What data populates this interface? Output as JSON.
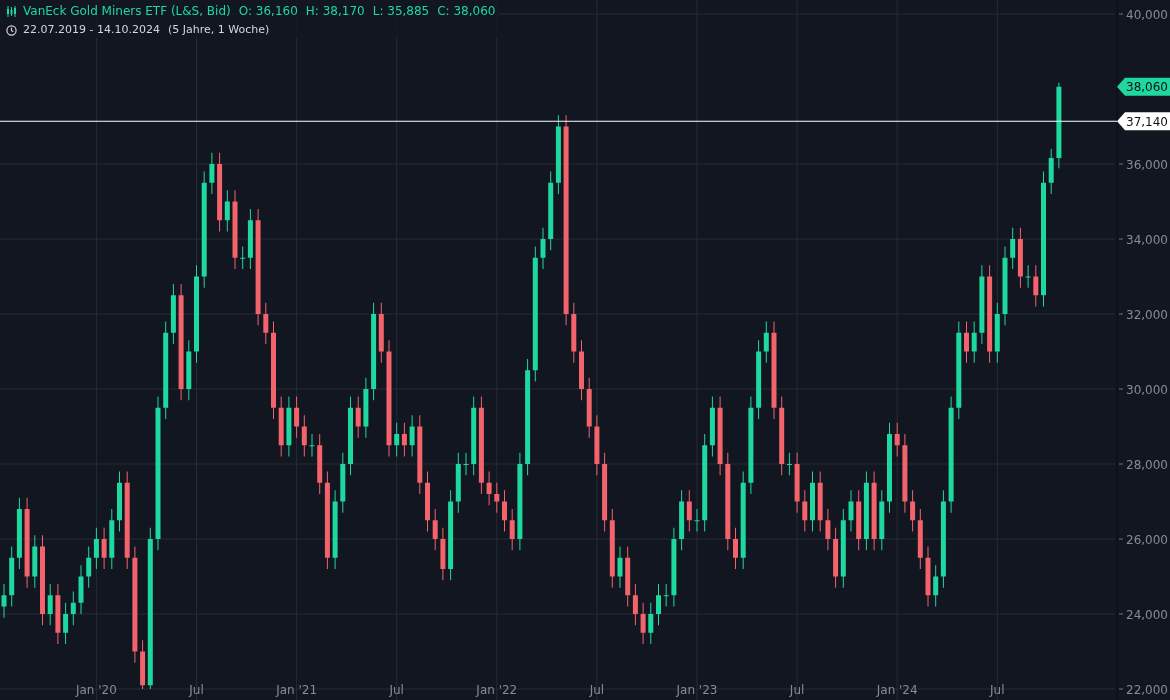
{
  "header": {
    "title": "VanEck Gold Miners ETF (L&S, Bid)",
    "ohlc": [
      "O: 36,160",
      "H: 38,170",
      "L: 35,885",
      "C: 38,060"
    ],
    "range": "22.07.2019 - 14.10.2024",
    "duration": "(5 Jahre, 1 Woche)"
  },
  "chart": {
    "chart_data": {
      "type": "candlestick",
      "categories": [
        null,
        null,
        null,
        null,
        null,
        null,
        null,
        null,
        null,
        null,
        null,
        null,
        "Jan '20",
        null,
        null,
        null,
        null,
        null,
        null,
        null,
        null,
        null,
        null,
        null,
        null,
        "Jul",
        null,
        null,
        null,
        null,
        null,
        null,
        null,
        null,
        null,
        null,
        null,
        null,
        "Jan '21",
        null,
        null,
        null,
        null,
        null,
        null,
        null,
        null,
        null,
        null,
        null,
        null,
        "Jul",
        null,
        null,
        null,
        null,
        null,
        null,
        null,
        null,
        null,
        null,
        null,
        null,
        "Jan '22",
        null,
        null,
        null,
        null,
        null,
        null,
        null,
        null,
        null,
        null,
        null,
        null,
        "Jul",
        null,
        null,
        null,
        null,
        null,
        null,
        null,
        null,
        null,
        null,
        null,
        null,
        "Jan '23",
        null,
        null,
        null,
        null,
        null,
        null,
        null,
        null,
        null,
        null,
        null,
        null,
        "Jul",
        null,
        null,
        null,
        null,
        null,
        null,
        null,
        null,
        null,
        null,
        null,
        null,
        "Jan '24",
        null,
        null,
        null,
        null,
        null,
        null,
        null,
        null,
        null,
        null,
        null,
        null,
        "Jul",
        null,
        null,
        null,
        null,
        null,
        null,
        null,
        null
      ],
      "ohlc": [
        [
          24200,
          24800,
          23900,
          24500
        ],
        [
          24500,
          25800,
          24200,
          25500
        ],
        [
          25500,
          27100,
          25200,
          26800
        ],
        [
          26800,
          27100,
          24700,
          25000
        ],
        [
          25000,
          26100,
          24700,
          25800
        ],
        [
          25800,
          26100,
          23700,
          24000
        ],
        [
          24000,
          24800,
          23700,
          24500
        ],
        [
          24500,
          24800,
          23200,
          23500
        ],
        [
          23500,
          24300,
          23200,
          24000
        ],
        [
          24000,
          24600,
          23700,
          24300
        ],
        [
          24300,
          25300,
          24000,
          25000
        ],
        [
          25000,
          25800,
          24700,
          25500
        ],
        [
          25500,
          26300,
          25200,
          26000
        ],
        [
          26000,
          26300,
          25200,
          25500
        ],
        [
          25500,
          26800,
          25200,
          26500
        ],
        [
          26500,
          27800,
          26200,
          27500
        ],
        [
          27500,
          27800,
          25200,
          25500
        ],
        [
          25500,
          25800,
          22700,
          23000
        ],
        [
          23000,
          23300,
          22000,
          22100
        ],
        [
          22100,
          26300,
          22000,
          26000
        ],
        [
          26000,
          29800,
          25700,
          29500
        ],
        [
          29500,
          31800,
          29200,
          31500
        ],
        [
          31500,
          32800,
          31200,
          32500
        ],
        [
          32500,
          32800,
          29700,
          30000
        ],
        [
          30000,
          31300,
          29700,
          31000
        ],
        [
          31000,
          33300,
          30700,
          33000
        ],
        [
          33000,
          35800,
          32700,
          35500
        ],
        [
          35500,
          36300,
          35200,
          36000
        ],
        [
          36000,
          36300,
          34200,
          34500
        ],
        [
          34500,
          35300,
          34200,
          35000
        ],
        [
          35000,
          35300,
          33200,
          33500
        ],
        [
          33500,
          33800,
          33200,
          33500
        ],
        [
          33500,
          34800,
          33200,
          34500
        ],
        [
          34500,
          34800,
          31700,
          32000
        ],
        [
          32000,
          32300,
          31200,
          31500
        ],
        [
          31500,
          31800,
          29200,
          29500
        ],
        [
          29500,
          29800,
          28200,
          28500
        ],
        [
          28500,
          29800,
          28200,
          29500
        ],
        [
          29500,
          29800,
          28700,
          29000
        ],
        [
          29000,
          29300,
          28200,
          28500
        ],
        [
          28500,
          28800,
          28200,
          28500
        ],
        [
          28500,
          28800,
          27200,
          27500
        ],
        [
          27500,
          27800,
          25200,
          25500
        ],
        [
          25500,
          27300,
          25200,
          27000
        ],
        [
          27000,
          28300,
          26700,
          28000
        ],
        [
          28000,
          29800,
          27700,
          29500
        ],
        [
          29500,
          29800,
          28700,
          29000
        ],
        [
          29000,
          30300,
          28700,
          30000
        ],
        [
          30000,
          32300,
          29700,
          32000
        ],
        [
          32000,
          32300,
          30700,
          31000
        ],
        [
          31000,
          31300,
          28200,
          28500
        ],
        [
          28500,
          29100,
          28200,
          28800
        ],
        [
          28800,
          29100,
          28200,
          28500
        ],
        [
          28500,
          29300,
          28200,
          29000
        ],
        [
          29000,
          29300,
          27200,
          27500
        ],
        [
          27500,
          27800,
          26200,
          26500
        ],
        [
          26500,
          26800,
          25700,
          26000
        ],
        [
          26000,
          26300,
          24900,
          25200
        ],
        [
          25200,
          27300,
          24900,
          27000
        ],
        [
          27000,
          28300,
          26700,
          28000
        ],
        [
          28000,
          28300,
          27700,
          28000
        ],
        [
          28000,
          29800,
          27700,
          29500
        ],
        [
          29500,
          29800,
          27200,
          27500
        ],
        [
          27500,
          27800,
          26900,
          27200
        ],
        [
          27200,
          27500,
          26700,
          27000
        ],
        [
          27000,
          27300,
          26200,
          26500
        ],
        [
          26500,
          26800,
          25700,
          26000
        ],
        [
          26000,
          28300,
          25700,
          28000
        ],
        [
          28000,
          30800,
          27700,
          30500
        ],
        [
          30500,
          33800,
          30200,
          33500
        ],
        [
          33500,
          34300,
          33200,
          34000
        ],
        [
          34000,
          35800,
          33700,
          35500
        ],
        [
          35500,
          37300,
          35200,
          37000
        ],
        [
          37000,
          37300,
          31700,
          32000
        ],
        [
          32000,
          32300,
          30700,
          31000
        ],
        [
          31000,
          31300,
          29700,
          30000
        ],
        [
          30000,
          30300,
          28700,
          29000
        ],
        [
          29000,
          29300,
          27700,
          28000
        ],
        [
          28000,
          28300,
          26200,
          26500
        ],
        [
          26500,
          26800,
          24700,
          25000
        ],
        [
          25000,
          25800,
          24700,
          25500
        ],
        [
          25500,
          25800,
          24200,
          24500
        ],
        [
          24500,
          24800,
          23700,
          24000
        ],
        [
          24000,
          24300,
          23200,
          23500
        ],
        [
          23500,
          24300,
          23200,
          24000
        ],
        [
          24000,
          24800,
          23700,
          24500
        ],
        [
          24500,
          24800,
          24200,
          24500
        ],
        [
          24500,
          26300,
          24200,
          26000
        ],
        [
          26000,
          27300,
          25700,
          27000
        ],
        [
          27000,
          27300,
          26200,
          26500
        ],
        [
          26500,
          26800,
          26200,
          26500
        ],
        [
          26500,
          28800,
          26200,
          28500
        ],
        [
          28500,
          29800,
          28200,
          29500
        ],
        [
          29500,
          29800,
          27700,
          28000
        ],
        [
          28000,
          28300,
          25700,
          26000
        ],
        [
          26000,
          26300,
          25200,
          25500
        ],
        [
          25500,
          27800,
          25200,
          27500
        ],
        [
          27500,
          29800,
          27200,
          29500
        ],
        [
          29500,
          31300,
          29200,
          31000
        ],
        [
          31000,
          31800,
          30700,
          31500
        ],
        [
          31500,
          31800,
          29200,
          29500
        ],
        [
          29500,
          29800,
          27700,
          28000
        ],
        [
          28000,
          28300,
          27700,
          28000
        ],
        [
          28000,
          28300,
          26700,
          27000
        ],
        [
          27000,
          27300,
          26200,
          26500
        ],
        [
          26500,
          27800,
          26200,
          27500
        ],
        [
          27500,
          27800,
          26200,
          26500
        ],
        [
          26500,
          26800,
          25700,
          26000
        ],
        [
          26000,
          26300,
          24700,
          25000
        ],
        [
          25000,
          26800,
          24700,
          26500
        ],
        [
          26500,
          27300,
          26200,
          27000
        ],
        [
          27000,
          27300,
          25700,
          26000
        ],
        [
          26000,
          27800,
          25700,
          27500
        ],
        [
          27500,
          27800,
          25700,
          26000
        ],
        [
          26000,
          27300,
          25700,
          27000
        ],
        [
          27000,
          29100,
          26700,
          28800
        ],
        [
          28800,
          29100,
          28200,
          28500
        ],
        [
          28500,
          28800,
          26700,
          27000
        ],
        [
          27000,
          27300,
          26200,
          26500
        ],
        [
          26500,
          26800,
          25200,
          25500
        ],
        [
          25500,
          25800,
          24200,
          24500
        ],
        [
          24500,
          25300,
          24200,
          25000
        ],
        [
          25000,
          27300,
          24700,
          27000
        ],
        [
          27000,
          29800,
          26700,
          29500
        ],
        [
          29500,
          31800,
          29200,
          31500
        ],
        [
          31500,
          31800,
          30700,
          31000
        ],
        [
          31000,
          31800,
          30700,
          31500
        ],
        [
          31500,
          33300,
          31200,
          33000
        ],
        [
          33000,
          33300,
          30700,
          31000
        ],
        [
          31000,
          32300,
          30700,
          32000
        ],
        [
          32000,
          33800,
          31700,
          33500
        ],
        [
          33500,
          34300,
          33200,
          34000
        ],
        [
          34000,
          34300,
          32700,
          33000
        ],
        [
          33000,
          33300,
          32700,
          33000
        ],
        [
          33000,
          33300,
          32200,
          32500
        ],
        [
          32500,
          35800,
          32200,
          35500
        ],
        [
          35500,
          36400,
          35200,
          36160
        ],
        [
          36160,
          38170,
          35885,
          38060
        ]
      ],
      "ylim": [
        22000,
        40000
      ],
      "yticks": [
        {
          "value": 40000,
          "label": "40,000"
        },
        {
          "value": 36000,
          "label": "36,000"
        },
        {
          "value": 34000,
          "label": "34,000"
        },
        {
          "value": 32000,
          "label": "32,000"
        },
        {
          "value": 30000,
          "label": "30,000"
        },
        {
          "value": 28000,
          "label": "28,000"
        },
        {
          "value": 26000,
          "label": "26,000"
        },
        {
          "value": 24000,
          "label": "24,000"
        },
        {
          "value": 22000,
          "label": "22,000"
        }
      ],
      "grid": true,
      "ref_lines": [
        {
          "axis": "y",
          "value": 37140,
          "label": "37,140"
        }
      ],
      "annotations": [
        "38,060"
      ]
    }
  }
}
